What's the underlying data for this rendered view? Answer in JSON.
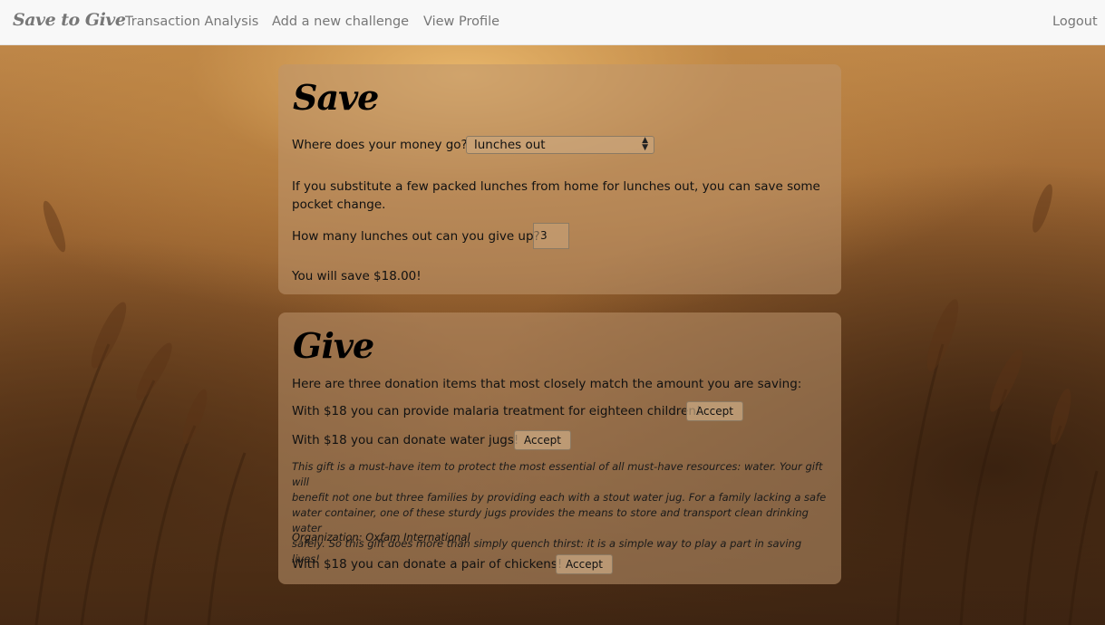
{
  "nav": {
    "brand": "Save to Give",
    "links": [
      "Transaction Analysis",
      "Add a new challenge",
      "View Profile"
    ],
    "logout": "Logout"
  },
  "save": {
    "title": "Save",
    "question": "Where does your money go?",
    "selected_category": "lunches out",
    "tip_line1": "If you substitute a few packed lunches from home for lunches out, you can save some",
    "tip_line2": "pocket change.",
    "count_question": "How many lunches out can you give up?",
    "count_value": "3",
    "result": "You will save $18.00!"
  },
  "give": {
    "title": "Give",
    "intro": "Here are three donation items that most closely match the amount you are saving:",
    "items": [
      {
        "text": "With $18 you can provide malaria treatment for eighteen children!",
        "button": "Accept"
      },
      {
        "text": "With $18 you can donate water jugs!",
        "button": "Accept"
      },
      {
        "text": "With $18 you can donate a pair of chickens!",
        "button": "Accept"
      }
    ],
    "description_lines": [
      "This gift is a must-have item to protect the most essential of all must-have resources: water. Your gift will",
      "benefit not one but three families by providing each with a stout water jug. For a family lacking a safe",
      "water container, one of these sturdy jugs provides the means to store and transport clean drinking water",
      "safely. So this gift does more than simply quench thirst: it is a simple way to play a part in saving lives!"
    ],
    "organization": "Organization: Oxfam International"
  }
}
